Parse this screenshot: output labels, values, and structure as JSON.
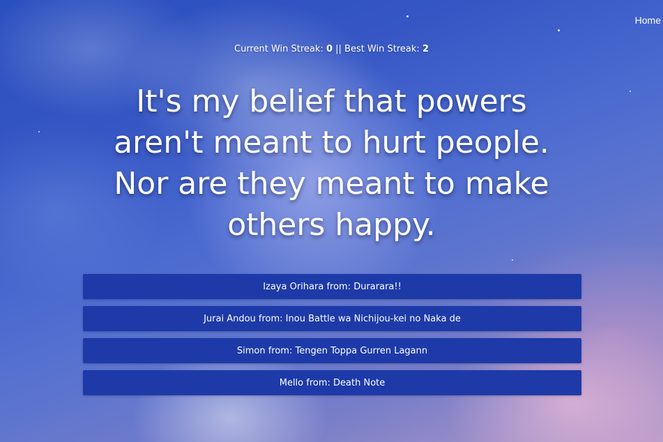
{
  "nav": {
    "home_label": "Home"
  },
  "streak": {
    "current_label": "Current Win Streak:",
    "current_value": "0",
    "separator": "||",
    "best_label": "Best Win Streak:",
    "best_value": "2"
  },
  "quote": {
    "text": "It's my belief that powers aren't meant to hurt people. Nor are they meant to make others happy."
  },
  "answers": [
    {
      "label": "Izaya Orihara from: Durarara!!"
    },
    {
      "label": "Jurai Andou from: Inou Battle wa Nichijou-kei no Naka de"
    },
    {
      "label": "Simon from: Tengen Toppa Gurren Lagann"
    },
    {
      "label": "Mello from: Death Note"
    }
  ],
  "colors": {
    "button_bg": "#1d3aa8",
    "text": "#ffffff",
    "sky_top": "#2a4fbf",
    "sky_bottom": "#b89ac8"
  }
}
